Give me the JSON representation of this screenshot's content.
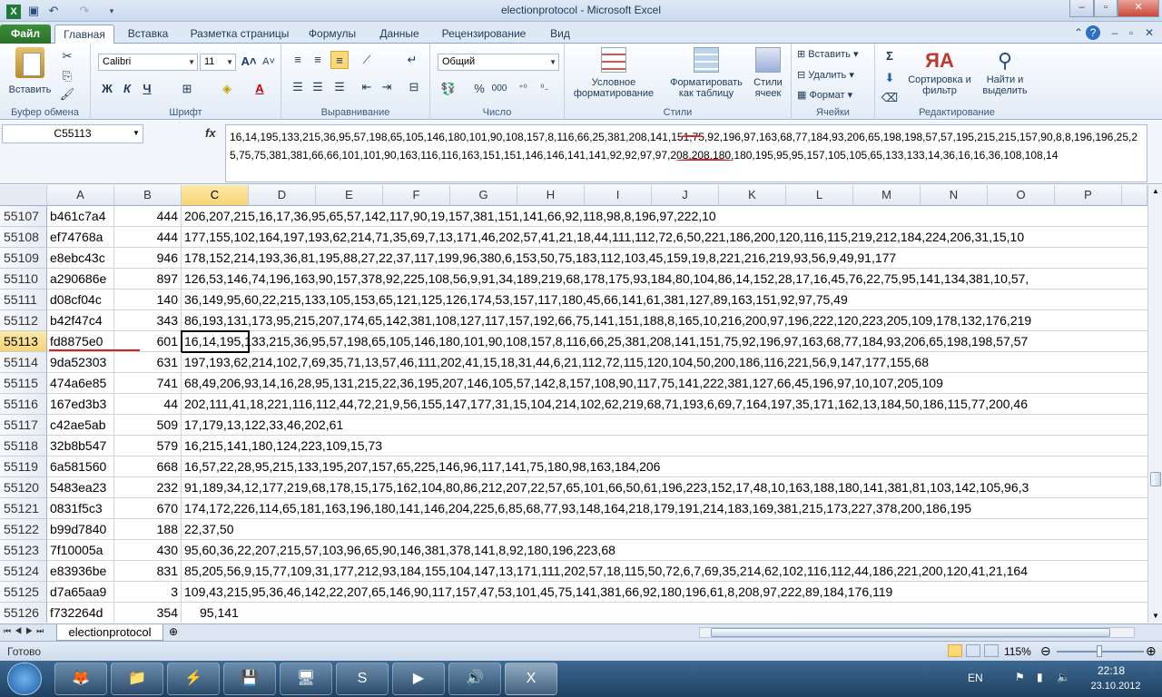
{
  "window": {
    "title": "electionprotocol  -  Microsoft Excel",
    "btn_min": "–",
    "btn_max": "▫",
    "btn_close": "✕"
  },
  "tabs": {
    "file": "Файл",
    "home": "Главная",
    "insert": "Вставка",
    "page_layout": "Разметка страницы",
    "formulas": "Формулы",
    "data": "Данные",
    "review": "Рецензирование",
    "view": "Вид"
  },
  "ribbon": {
    "clipboard": {
      "label": "Буфер обмена",
      "paste": "Вставить"
    },
    "font": {
      "label": "Шрифт",
      "name": "Calibri",
      "size": "11",
      "bold": "Ж",
      "italic": "К",
      "underline": "Ч"
    },
    "alignment": {
      "label": "Выравнивание"
    },
    "number": {
      "label": "Число",
      "format": "Общий",
      "percent": "%",
      "thousands": "000"
    },
    "styles": {
      "label": "Стили",
      "conditional": "Условное форматирование",
      "as_table": "Форматировать как таблицу",
      "cell_styles": "Стили ячеек"
    },
    "cells": {
      "label": "Ячейки",
      "insert": "Вставить",
      "delete": "Удалить",
      "format": "Формат"
    },
    "editing": {
      "label": "Редактирование",
      "sort": "Сортировка и фильтр",
      "find": "Найти и выделить"
    }
  },
  "formula_bar": {
    "name_box": "C55113",
    "fx": "fx",
    "value": "16,14,195,133,215,36,95,57,198,65,105,146,180,101,90,108,157,8,116,66,25,381,208,141,151,75,92,196,97,163,68,77,184,93,206,65,198,198,57,57,195,215,215,157,90,8,8,196,196,25,25,75,75,381,381,66,66,101,101,90,163,116,116,163,151,151,146,146,141,141,92,92,97,97,208,208,180,180,195,95,95,157,105,105,65,133,133,14,36,16,16,36,108,108,14"
  },
  "columns": [
    "A",
    "B",
    "C",
    "D",
    "E",
    "F",
    "G",
    "H",
    "I",
    "J",
    "K",
    "L",
    "M",
    "N",
    "O",
    "P"
  ],
  "rows": [
    {
      "n": "55107",
      "a": "b461c7a4",
      "b": "444",
      "c": "206,207,215,16,17,36,95,65,57,142,117,90,19,157,381,151,141,66,92,118,98,8,196,97,222,10"
    },
    {
      "n": "55108",
      "a": "ef74768a",
      "b": "444",
      "c": "177,155,102,164,197,193,62,214,71,35,69,7,13,171,46,202,57,41,21,18,44,111,112,72,6,50,221,186,200,120,116,115,219,212,184,224,206,31,15,10"
    },
    {
      "n": "55109",
      "a": "e8ebc43c",
      "b": "946",
      "c": "178,152,214,193,36,81,195,88,27,22,37,117,199,96,380,6,153,50,75,183,112,103,45,159,19,8,221,216,219,93,56,9,49,91,177"
    },
    {
      "n": "55110",
      "a": "a290686e",
      "b": "897",
      "c": "126,53,146,74,196,163,90,157,378,92,225,108,56,9,91,34,189,219,68,178,175,93,184,80,104,86,14,152,28,17,16,45,76,22,75,95,141,134,381,10,57,"
    },
    {
      "n": "55111",
      "a": "d08cf04c",
      "b": "140",
      "c": "36,149,95,60,22,215,133,105,153,65,121,125,126,174,53,157,117,180,45,66,141,61,381,127,89,163,151,92,97,75,49"
    },
    {
      "n": "55112",
      "a": "b42f47c4",
      "b": "343",
      "c": "86,193,131,173,95,215,207,174,65,142,381,108,127,117,157,192,66,75,141,151,188,8,165,10,216,200,97,196,222,120,223,205,109,178,132,176,219"
    },
    {
      "n": "55113",
      "a": "fd8875e0",
      "b": "601",
      "c": "16,14,195,133,215,36,95,57,198,65,105,146,180,101,90,108,157,8,116,66,25,381,208,141,151,75,92,196,97,163,68,77,184,93,206,65,198,198,57,57"
    },
    {
      "n": "55114",
      "a": "9da52303",
      "b": "631",
      "c": "197,193,62,214,102,7,69,35,71,13,57,46,111,202,41,15,18,31,44,6,21,112,72,115,120,104,50,200,186,116,221,56,9,147,177,155,68"
    },
    {
      "n": "55115",
      "a": "474a6e85",
      "b": "741",
      "c": "68,49,206,93,14,16,28,95,131,215,22,36,195,207,146,105,57,142,8,157,108,90,117,75,141,222,381,127,66,45,196,97,10,107,205,109"
    },
    {
      "n": "55116",
      "a": "167ed3b3",
      "b": "44",
      "c": "202,111,41,18,221,116,112,44,72,21,9,56,155,147,177,31,15,104,214,102,62,219,68,71,193,6,69,7,164,197,35,171,162,13,184,50,186,115,77,200,46"
    },
    {
      "n": "55117",
      "a": "c42ae5ab",
      "b": "509",
      "c": "17,179,13,122,33,46,202,61"
    },
    {
      "n": "55118",
      "a": "32b8b547",
      "b": "579",
      "c": "16,215,141,180,124,223,109,15,73"
    },
    {
      "n": "55119",
      "a": "6a581560",
      "b": "668",
      "c": "16,57,22,28,95,215,133,195,207,157,65,225,146,96,117,141,75,180,98,163,184,206"
    },
    {
      "n": "55120",
      "a": "5483ea23",
      "b": "232",
      "c": "91,189,34,12,177,219,68,178,15,175,162,104,80,86,212,207,22,57,65,101,66,50,61,196,223,152,17,48,10,163,188,180,141,381,81,103,142,105,96,3"
    },
    {
      "n": "55121",
      "a": "0831f5c3",
      "b": "670",
      "c": "174,172,226,114,65,181,163,196,180,141,146,204,225,6,85,68,77,93,148,164,218,179,191,214,183,169,381,215,173,227,378,200,186,195"
    },
    {
      "n": "55122",
      "a": "b99d7840",
      "b": "188",
      "c": "22,37,50"
    },
    {
      "n": "55123",
      "a": "7f10005a",
      "b": "430",
      "c": "95,60,36,22,207,215,57,103,96,65,90,146,381,378,141,8,92,180,196,223,68"
    },
    {
      "n": "55124",
      "a": "e83936be",
      "b": "831",
      "c": "85,205,56,9,15,77,109,31,177,212,93,184,155,104,147,13,171,111,202,57,18,115,50,72,6,7,69,35,214,62,102,116,112,44,186,221,200,120,41,21,164"
    },
    {
      "n": "55125",
      "a": "d7a65aa9",
      "b": "3",
      "c": "109,43,215,95,36,46,142,22,207,65,146,90,117,157,47,53,101,45,75,141,381,66,92,180,196,61,8,208,97,222,89,184,176,119"
    },
    {
      "n": "55126",
      "a": "f732264d",
      "b": "354",
      "c": "95,141"
    }
  ],
  "sheet": {
    "tab": "electionprotocol"
  },
  "status": {
    "ready": "Готово",
    "zoom": "115%"
  },
  "taskbar": {
    "lang": "EN",
    "time": "22:18",
    "date": "23.10.2012"
  }
}
